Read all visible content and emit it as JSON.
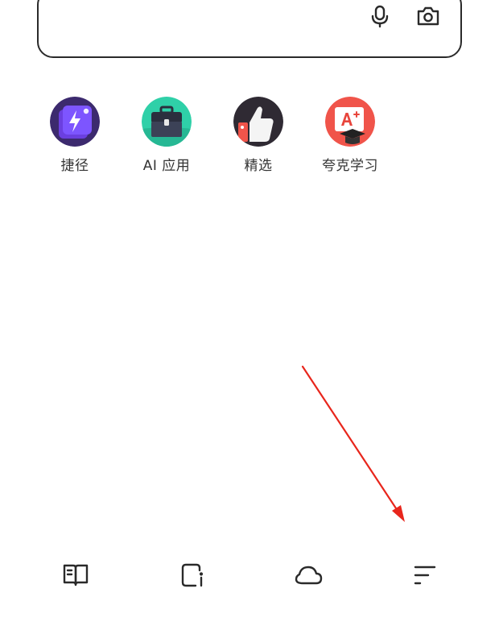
{
  "search": {
    "icons": {
      "mic": "microphone-icon",
      "camera": "camera-icon"
    }
  },
  "shortcuts": [
    {
      "label": "捷径",
      "icon": "lightning-shortcut-icon"
    },
    {
      "label": "AI 应用",
      "icon": "toolbox-icon"
    },
    {
      "label": "精选",
      "icon": "thumbs-up-icon"
    },
    {
      "label": "夸克学习",
      "icon": "graduation-cap-icon"
    }
  ],
  "bottom_nav": [
    {
      "name": "reader",
      "icon": "book-icon"
    },
    {
      "name": "tabs",
      "icon": "window-icon"
    },
    {
      "name": "cloud",
      "icon": "cloud-icon"
    },
    {
      "name": "menu",
      "icon": "menu-lines-icon"
    }
  ],
  "colors": {
    "outline": "#2a2a2a",
    "annotation_arrow": "#e8261c",
    "shortcut_purple": "#6b3fe0",
    "shortcut_teal": "#2fd0a8",
    "shortcut_dark": "#3a2f3a",
    "shortcut_red": "#f0544a"
  }
}
